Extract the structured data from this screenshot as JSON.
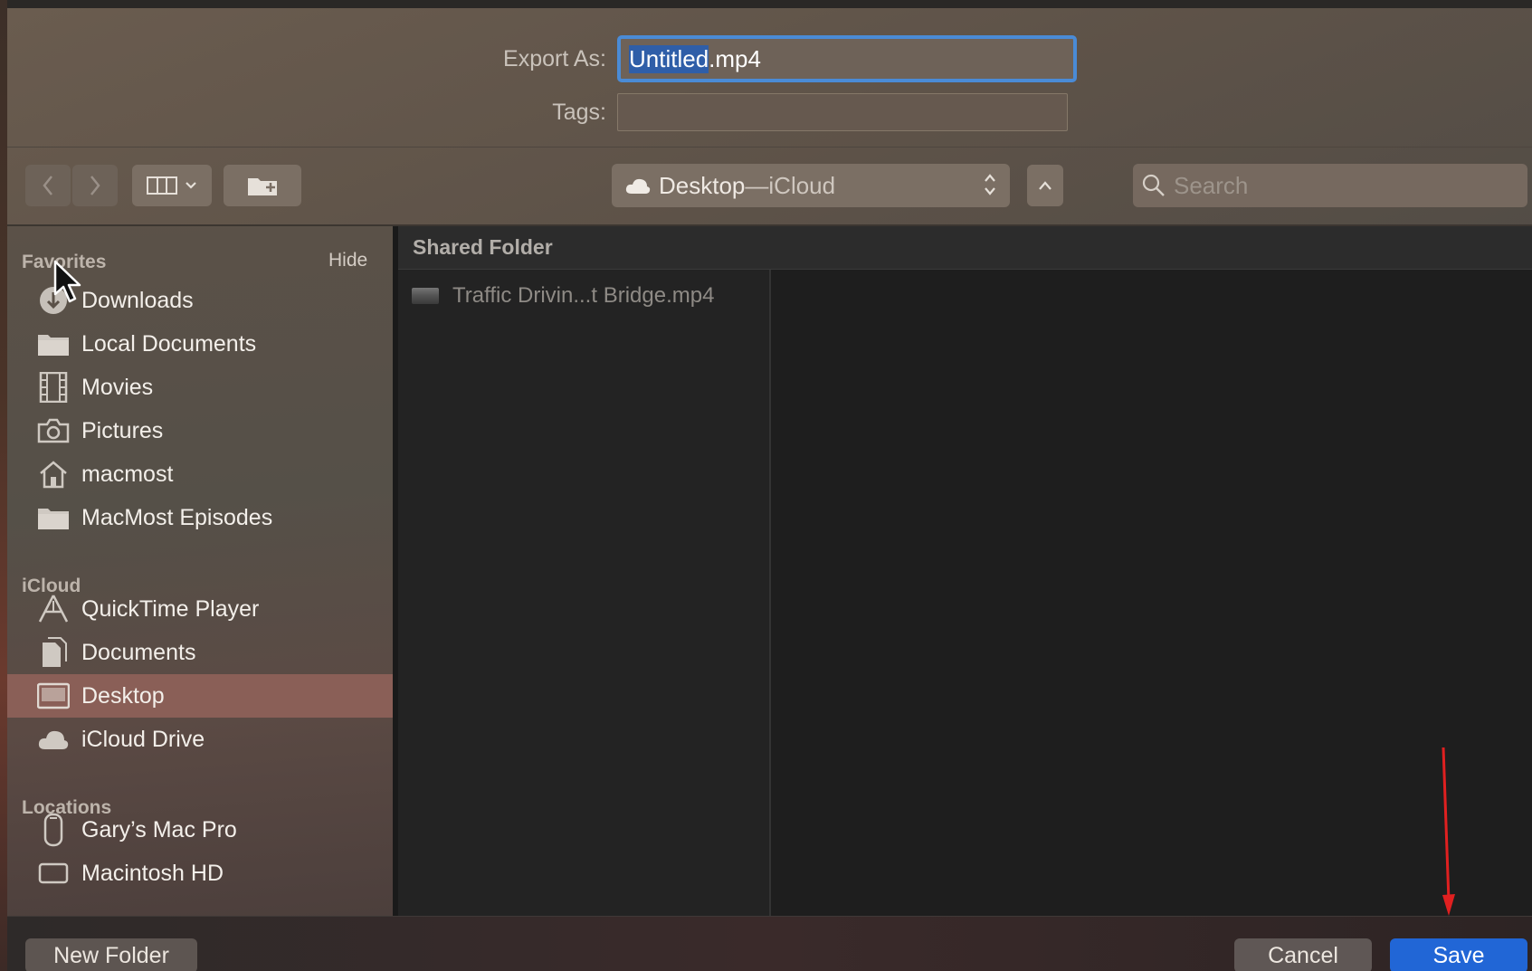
{
  "export_form": {
    "export_label": "Export As:",
    "filename_selected": "Untitled",
    "filename_ext": ".mp4",
    "tags_label": "Tags:"
  },
  "toolbar": {
    "location_name": "Desktop",
    "location_separator": " — ",
    "location_service": "iCloud",
    "search_placeholder": "Search"
  },
  "sidebar": {
    "favorites_heading": "Favorites",
    "hide_label": "Hide",
    "favorites": [
      {
        "label": "Downloads",
        "icon": "downloads-icon"
      },
      {
        "label": "Local Documents",
        "icon": "folder-icon"
      },
      {
        "label": "Movies",
        "icon": "film-icon"
      },
      {
        "label": "Pictures",
        "icon": "camera-icon"
      },
      {
        "label": "macmost",
        "icon": "home-icon"
      },
      {
        "label": "MacMost Episodes",
        "icon": "folder-icon"
      }
    ],
    "icloud_heading": "iCloud",
    "icloud": [
      {
        "label": "QuickTime Player",
        "icon": "app-icon"
      },
      {
        "label": "Documents",
        "icon": "documents-icon"
      },
      {
        "label": "Desktop",
        "icon": "desktop-icon",
        "selected": true
      },
      {
        "label": "iCloud Drive",
        "icon": "cloud-icon"
      }
    ],
    "locations_heading": "Locations",
    "locations": [
      {
        "label": "Gary’s Mac Pro",
        "icon": "mac-pro-icon"
      },
      {
        "label": "Macintosh HD",
        "icon": "disk-icon"
      }
    ]
  },
  "browser": {
    "column_header": "Shared Folder",
    "files": [
      {
        "name": "Traffic Drivin...t Bridge.mp4",
        "icon": "video-thumbnail-icon"
      }
    ]
  },
  "buttons": {
    "new_folder": "New Folder",
    "cancel": "Cancel",
    "save": "Save"
  },
  "colors": {
    "accent": "#2166d6",
    "focus_ring": "#4a8bd6",
    "selected_sidebar": "#8a5f57",
    "annotation_arrow": "#e02020"
  }
}
